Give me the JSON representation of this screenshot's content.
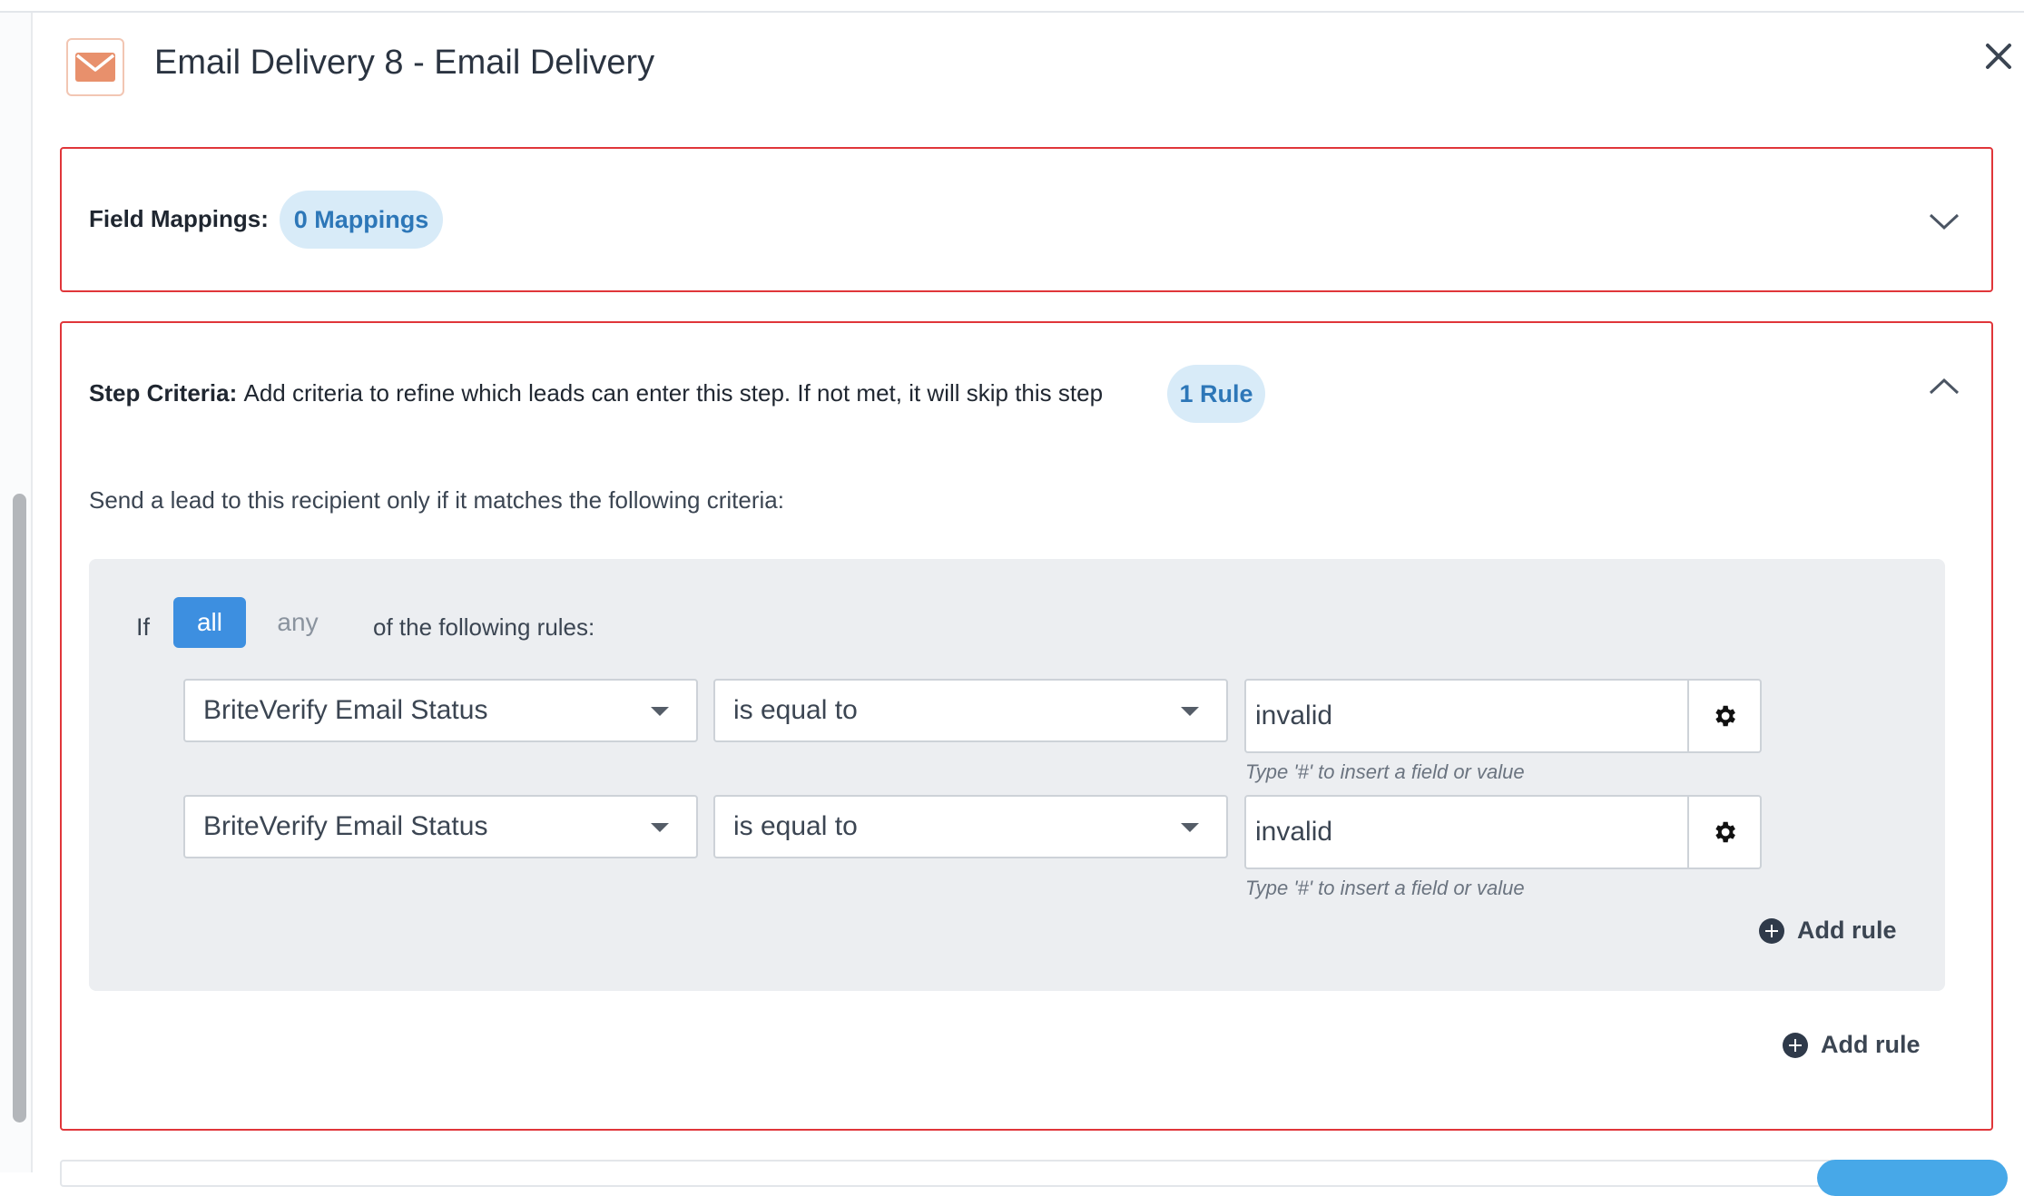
{
  "header": {
    "title": "Email Delivery 8 - Email Delivery",
    "icon": "envelope-icon",
    "icon_color": "#e8906c",
    "close_icon": "close-icon"
  },
  "field_mappings": {
    "label": "Field Mappings:",
    "count_badge": "0 Mappings",
    "expanded": false
  },
  "step_criteria": {
    "label": "Step Criteria:",
    "description": "Add criteria to refine which leads can enter this step. If not met, it will skip this step",
    "count_badge": "1 Rule",
    "expanded": true,
    "intro": "Send a lead to this recipient only if it matches the following criteria:",
    "group": {
      "if_label": "If",
      "match_options": [
        "all",
        "any"
      ],
      "selected_match": "all",
      "following_label": "of the following rules:",
      "rules": [
        {
          "field": "BriteVerify Email Status",
          "operator": "is equal to",
          "value": "invalid",
          "hint": "Type '#' to insert a field or value"
        },
        {
          "field": "BriteVerify Email Status",
          "operator": "is equal to",
          "value": "invalid",
          "hint": "Type '#' to insert a field or value"
        }
      ],
      "add_rule_label": "Add rule"
    },
    "add_rule_label": "Add rule"
  },
  "colors": {
    "panel_border": "#e0363a",
    "badge_bg": "#d8ebf8",
    "badge_text": "#2d77b8",
    "selected_segment": "#3d8fe0",
    "rules_bg": "#eceef1"
  }
}
